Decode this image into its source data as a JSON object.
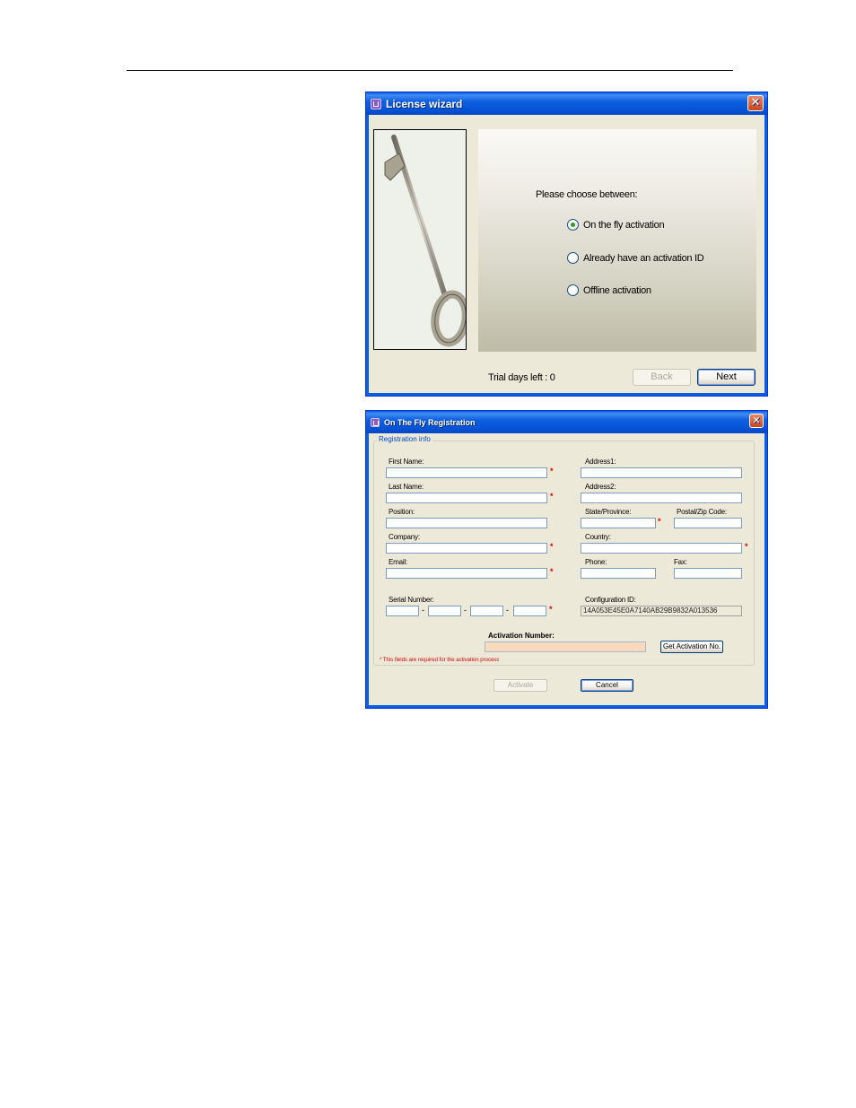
{
  "wizard": {
    "title": "License wizard",
    "image": "key-image",
    "prompt": "Please choose between:",
    "options": [
      {
        "label": "On the fly activation",
        "checked": true
      },
      {
        "label": "Already have an activation ID",
        "checked": false
      },
      {
        "label": "Offline activation",
        "checked": false
      }
    ],
    "trial_text": "Trial days left : 0",
    "back_label": "Back",
    "back_enabled": false,
    "next_label": "Next"
  },
  "registration": {
    "title": "On The Fly Registration",
    "group_label": "Registration info",
    "fields": {
      "first_name": {
        "label": "First Name:",
        "value": "",
        "required": true
      },
      "last_name": {
        "label": "Last Name:",
        "value": "",
        "required": true
      },
      "position": {
        "label": "Position:",
        "value": "",
        "required": false
      },
      "company": {
        "label": "Company:",
        "value": "",
        "required": true
      },
      "email": {
        "label": "Email:",
        "value": "",
        "required": true
      },
      "address1": {
        "label": "Address1:",
        "value": "",
        "required": false
      },
      "address2": {
        "label": "Address2:",
        "value": "",
        "required": false
      },
      "state": {
        "label": "State/Province:",
        "value": "",
        "required": true
      },
      "postal": {
        "label": "Postal/Zip Code:",
        "value": "",
        "required": false
      },
      "country": {
        "label": "Country:",
        "value": "",
        "required": true
      },
      "phone": {
        "label": "Phone:",
        "value": "",
        "required": false
      },
      "fax": {
        "label": "Fax:",
        "value": "",
        "required": false
      }
    },
    "serial_label": "Serial Number:",
    "serial_parts": [
      "",
      "",
      "",
      ""
    ],
    "serial_separator": "-",
    "config_label": "Configuration ID:",
    "config_value": "14A053E45E0A7140AB29B9832A013536",
    "activation_label": "Activation Number:",
    "activation_value": "",
    "get_activation_label": "Get Activation No.",
    "required_note": "* This fields are required for the activation process",
    "required_marker": "*",
    "activate_label": "Activate",
    "activate_enabled": false,
    "cancel_label": "Cancel"
  },
  "colors": {
    "title_bar": "#0655d8",
    "dialog_bg": "#ece9d8",
    "required": "#e00000",
    "activation_field": "#fcd9bc",
    "group_label": "#0046d5"
  }
}
